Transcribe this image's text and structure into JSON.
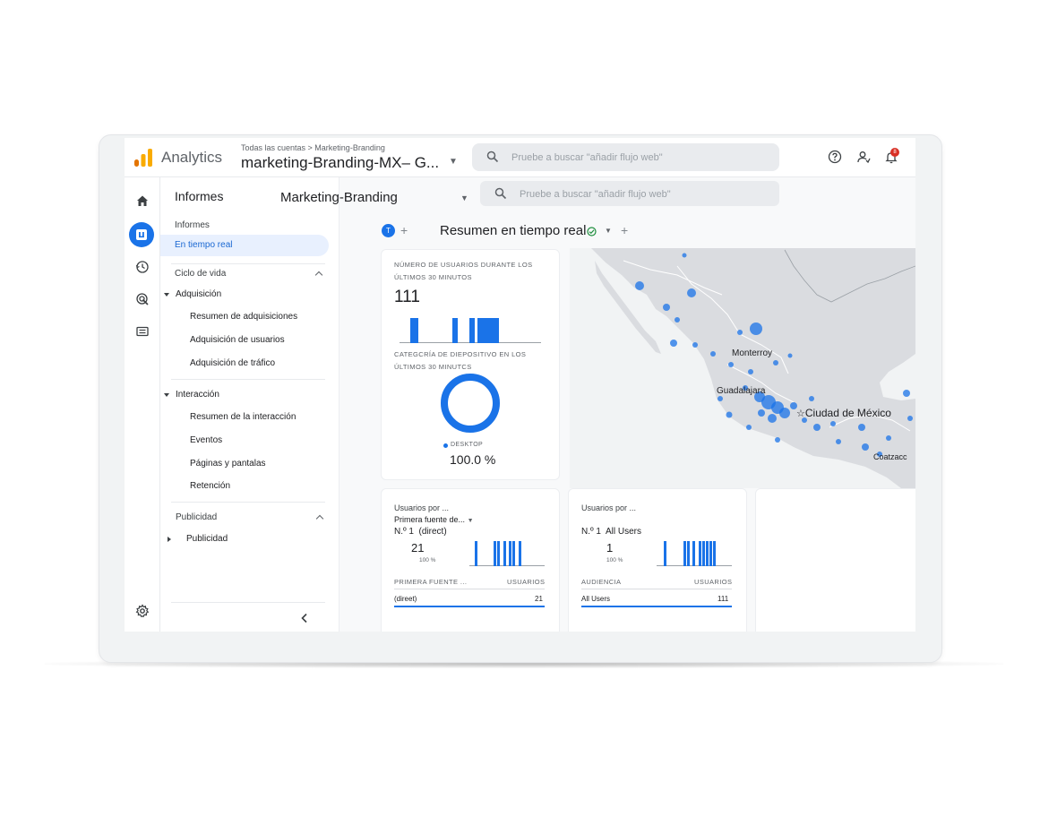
{
  "header": {
    "app_name": "Analytics",
    "breadcrumb": "Todas las cuentas > Marketing-Branding",
    "property_title": "marketing-Branding-MX– G...",
    "search_placeholder": "Pruebe a buscar \"añadir flujo web\"",
    "notification_count": "8"
  },
  "sidenav": {
    "title": "Informes",
    "section_label": "Informes",
    "active_item": "En tiempo real",
    "lifecycle_label": "Ciclo de vida",
    "groups": [
      {
        "label": "Adquisición",
        "items": [
          "Resumen de adquisiciones",
          "Adquisición de usuarios",
          "Adquisición de tráfico"
        ]
      },
      {
        "label": "Interacción",
        "items": [
          "Resumen de la interacción",
          "Eventos",
          "Páginas y pantalas",
          "Retención"
        ]
      }
    ],
    "advertising_label": "Publicidad",
    "advertising_item": "Publicidad",
    "collapse_icon": "chevron-left-icon"
  },
  "content": {
    "property_name": "Marketing-Branding",
    "search_placeholder": "Pruebe a buscar \"añadir flujo web\"",
    "tab_chip": "T",
    "page_title": "Resumen en tiempo real"
  },
  "users_card": {
    "label_line1": "NÚMERO DE USUARIOS DURANTE LOS",
    "label_line2": "ÚLTIMOS 30 MINUTOS",
    "value": "111",
    "device_label_line1": "CATEGCRÍA DE DIEPOSITIVO EN LOS",
    "device_label_line2": "ÚLTIMOS 30 MINUTCS",
    "device_legend": "DESKTOP",
    "device_percent": "100.0 %",
    "donut_fraction": 1.0
  },
  "map": {
    "labels": [
      "Monterroy",
      "Guadalajara",
      "Ciudad de México",
      "Coatzacc"
    ]
  },
  "source_card": {
    "title": "Usuarios por ...",
    "dropdown": "Primera fuente de...",
    "rank": "N.º 1  (direct)",
    "value": "21",
    "percent": "100 %",
    "col1": "PRIMERA FUENTE ...",
    "col2": "USUARIOS",
    "row_name": "(direet)",
    "row_value": "21"
  },
  "audience_card": {
    "title": "Usuarios por ...",
    "rank": "N.º 1  All Users",
    "value": "1",
    "percent": "100 %",
    "col1": "AUDIENCIA",
    "col2": "USUARIOS",
    "row_name": "All Users",
    "row_value": "111"
  },
  "colors": {
    "accent": "#1a73e8",
    "logo_orange": "#f9ab00",
    "logo_dark": "#e37400",
    "map_land": "#dadce0",
    "map_point": "#1a73e8"
  }
}
